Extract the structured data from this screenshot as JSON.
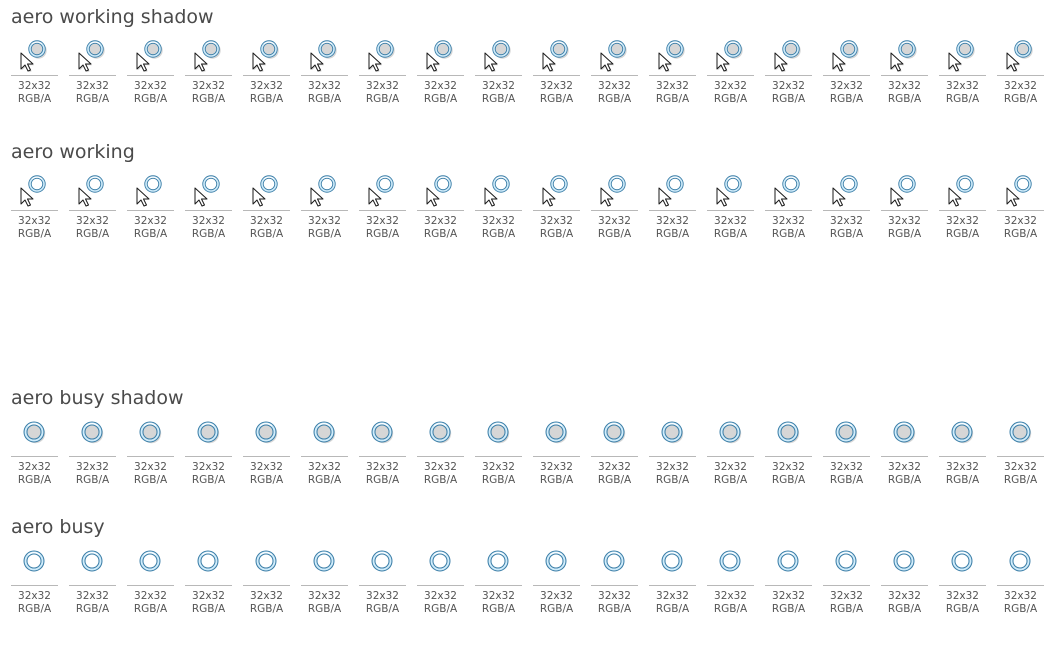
{
  "window": {
    "title": ""
  },
  "colors": {
    "ring_outer": "#3d7fa8",
    "ring_highlight": "#d8f2ff",
    "ring_shadow": "#8a8a8a",
    "arrow_fill": "#ffffff",
    "arrow_stroke": "#1a1a1a",
    "label_text": "#555555",
    "title_text": "#4a4a4a",
    "rule": "#b8b8b8"
  },
  "sections": [
    {
      "id": "aero-working-shadow",
      "title": "aero working shadow",
      "icon": "busy-arrow-shadow-icon",
      "frames": [
        {
          "size": "32x32",
          "format": "RGB/A"
        },
        {
          "size": "32x32",
          "format": "RGB/A"
        },
        {
          "size": "32x32",
          "format": "RGB/A"
        },
        {
          "size": "32x32",
          "format": "RGB/A"
        },
        {
          "size": "32x32",
          "format": "RGB/A"
        },
        {
          "size": "32x32",
          "format": "RGB/A"
        },
        {
          "size": "32x32",
          "format": "RGB/A"
        },
        {
          "size": "32x32",
          "format": "RGB/A"
        },
        {
          "size": "32x32",
          "format": "RGB/A"
        },
        {
          "size": "32x32",
          "format": "RGB/A"
        },
        {
          "size": "32x32",
          "format": "RGB/A"
        },
        {
          "size": "32x32",
          "format": "RGB/A"
        },
        {
          "size": "32x32",
          "format": "RGB/A"
        },
        {
          "size": "32x32",
          "format": "RGB/A"
        },
        {
          "size": "32x32",
          "format": "RGB/A"
        },
        {
          "size": "32x32",
          "format": "RGB/A"
        },
        {
          "size": "32x32",
          "format": "RGB/A"
        },
        {
          "size": "32x32",
          "format": "RGB/A"
        }
      ]
    },
    {
      "id": "aero-working",
      "title": "aero working",
      "icon": "busy-arrow-icon",
      "frames": [
        {
          "size": "32x32",
          "format": "RGB/A"
        },
        {
          "size": "32x32",
          "format": "RGB/A"
        },
        {
          "size": "32x32",
          "format": "RGB/A"
        },
        {
          "size": "32x32",
          "format": "RGB/A"
        },
        {
          "size": "32x32",
          "format": "RGB/A"
        },
        {
          "size": "32x32",
          "format": "RGB/A"
        },
        {
          "size": "32x32",
          "format": "RGB/A"
        },
        {
          "size": "32x32",
          "format": "RGB/A"
        },
        {
          "size": "32x32",
          "format": "RGB/A"
        },
        {
          "size": "32x32",
          "format": "RGB/A"
        },
        {
          "size": "32x32",
          "format": "RGB/A"
        },
        {
          "size": "32x32",
          "format": "RGB/A"
        },
        {
          "size": "32x32",
          "format": "RGB/A"
        },
        {
          "size": "32x32",
          "format": "RGB/A"
        },
        {
          "size": "32x32",
          "format": "RGB/A"
        },
        {
          "size": "32x32",
          "format": "RGB/A"
        },
        {
          "size": "32x32",
          "format": "RGB/A"
        },
        {
          "size": "32x32",
          "format": "RGB/A"
        }
      ]
    },
    {
      "id": "aero-busy-shadow",
      "title": "aero busy shadow",
      "icon": "busy-ring-shadow-icon",
      "frames": [
        {
          "size": "32x32",
          "format": "RGB/A"
        },
        {
          "size": "32x32",
          "format": "RGB/A"
        },
        {
          "size": "32x32",
          "format": "RGB/A"
        },
        {
          "size": "32x32",
          "format": "RGB/A"
        },
        {
          "size": "32x32",
          "format": "RGB/A"
        },
        {
          "size": "32x32",
          "format": "RGB/A"
        },
        {
          "size": "32x32",
          "format": "RGB/A"
        },
        {
          "size": "32x32",
          "format": "RGB/A"
        },
        {
          "size": "32x32",
          "format": "RGB/A"
        },
        {
          "size": "32x32",
          "format": "RGB/A"
        },
        {
          "size": "32x32",
          "format": "RGB/A"
        },
        {
          "size": "32x32",
          "format": "RGB/A"
        },
        {
          "size": "32x32",
          "format": "RGB/A"
        },
        {
          "size": "32x32",
          "format": "RGB/A"
        },
        {
          "size": "32x32",
          "format": "RGB/A"
        },
        {
          "size": "32x32",
          "format": "RGB/A"
        },
        {
          "size": "32x32",
          "format": "RGB/A"
        },
        {
          "size": "32x32",
          "format": "RGB/A"
        }
      ]
    },
    {
      "id": "aero-busy",
      "title": "aero busy",
      "icon": "busy-ring-icon",
      "frames": [
        {
          "size": "32x32",
          "format": "RGB/A"
        },
        {
          "size": "32x32",
          "format": "RGB/A"
        },
        {
          "size": "32x32",
          "format": "RGB/A"
        },
        {
          "size": "32x32",
          "format": "RGB/A"
        },
        {
          "size": "32x32",
          "format": "RGB/A"
        },
        {
          "size": "32x32",
          "format": "RGB/A"
        },
        {
          "size": "32x32",
          "format": "RGB/A"
        },
        {
          "size": "32x32",
          "format": "RGB/A"
        },
        {
          "size": "32x32",
          "format": "RGB/A"
        },
        {
          "size": "32x32",
          "format": "RGB/A"
        },
        {
          "size": "32x32",
          "format": "RGB/A"
        },
        {
          "size": "32x32",
          "format": "RGB/A"
        },
        {
          "size": "32x32",
          "format": "RGB/A"
        },
        {
          "size": "32x32",
          "format": "RGB/A"
        },
        {
          "size": "32x32",
          "format": "RGB/A"
        },
        {
          "size": "32x32",
          "format": "RGB/A"
        },
        {
          "size": "32x32",
          "format": "RGB/A"
        },
        {
          "size": "32x32",
          "format": "RGB/A"
        }
      ]
    }
  ]
}
